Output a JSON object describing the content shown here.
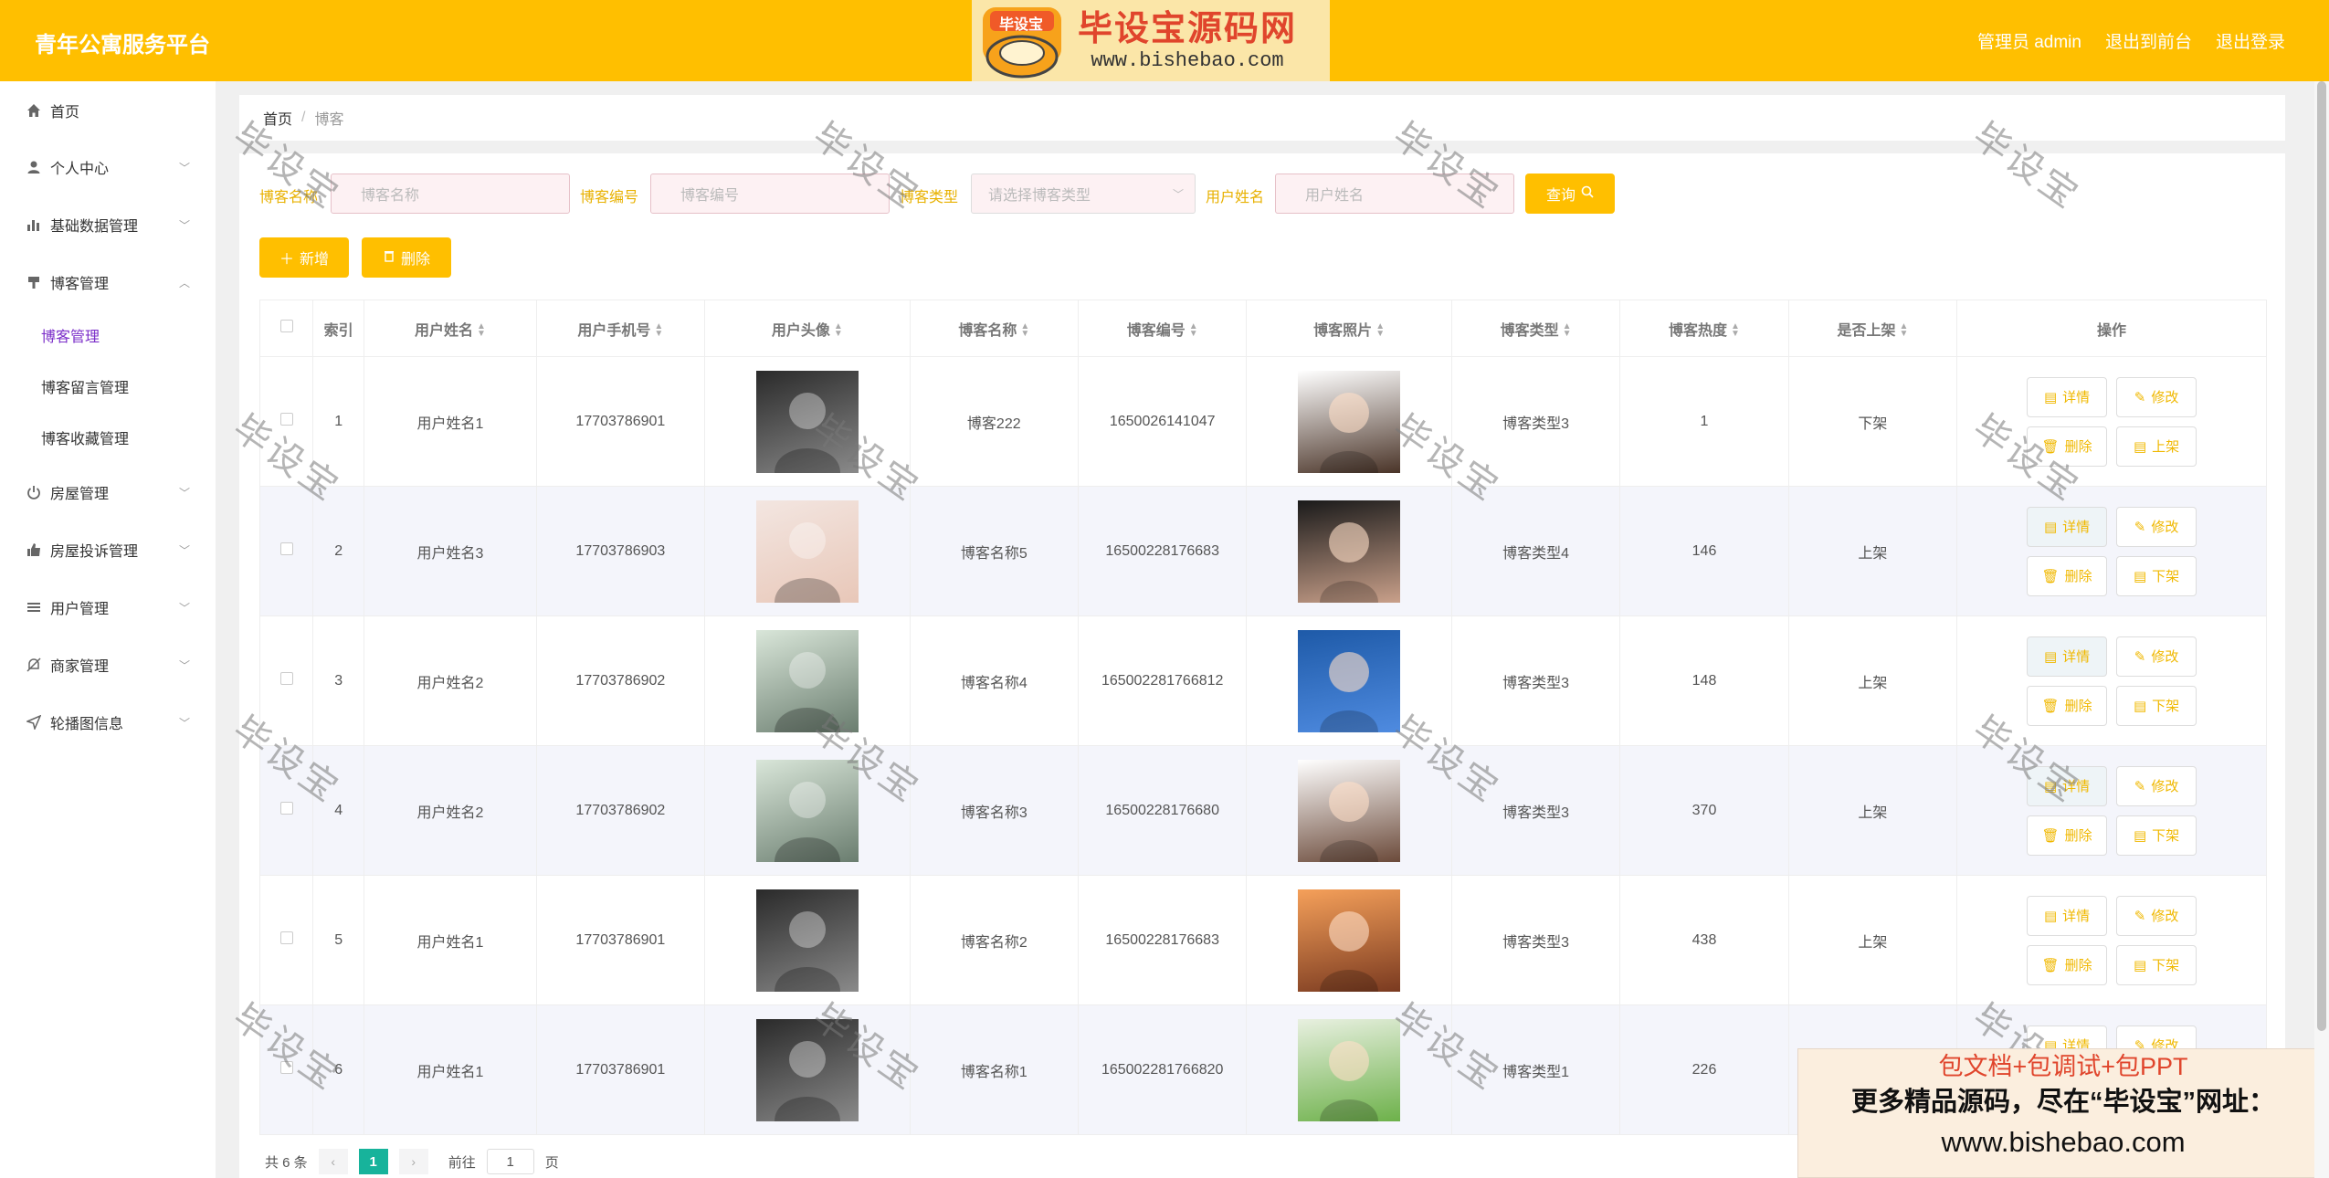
{
  "header": {
    "title": "青年公寓服务平台",
    "logo_title": "毕设宝源码网",
    "logo_url": "www.bishebao.com",
    "logo_badge": "毕设宝",
    "user_label": "管理员 admin",
    "to_front": "退出到前台",
    "logout": "退出登录",
    "bg_color": "#ffbf00"
  },
  "sidebar": {
    "items": [
      {
        "label": "首页",
        "icon": "home-icon"
      },
      {
        "label": "个人中心",
        "icon": "user-icon"
      },
      {
        "label": "基础数据管理",
        "icon": "bar-chart-icon"
      },
      {
        "label": "博客管理",
        "icon": "paint-icon"
      },
      {
        "label": "房屋管理",
        "icon": "power-icon"
      },
      {
        "label": "房屋投诉管理",
        "icon": "thumb-icon"
      },
      {
        "label": "用户管理",
        "icon": "list-icon"
      },
      {
        "label": "商家管理",
        "icon": "bell-off-icon"
      },
      {
        "label": "轮播图信息",
        "icon": "send-icon"
      }
    ],
    "sub_items": [
      {
        "label": "博客管理"
      },
      {
        "label": "博客留言管理"
      },
      {
        "label": "博客收藏管理"
      }
    ],
    "active_color": "#7b2ec9"
  },
  "breadcrumb": {
    "home": "首页",
    "sep": "/",
    "current": "博客"
  },
  "filters": {
    "name_label": "博客名称",
    "name_placeholder": "博客名称",
    "code_label": "博客编号",
    "code_placeholder": "博客编号",
    "type_label": "博客类型",
    "type_placeholder": "请选择博客类型",
    "user_label": "用户姓名",
    "user_placeholder": "用户姓名",
    "search_btn": "查询"
  },
  "actions": {
    "add": "新增",
    "delete": "删除"
  },
  "table": {
    "headers": [
      "索引",
      "用户姓名",
      "用户手机号",
      "用户头像",
      "博客名称",
      "博客编号",
      "博客照片",
      "博客类型",
      "博客热度",
      "是否上架",
      "操作"
    ],
    "rows": [
      {
        "idx": "1",
        "user": "用户姓名1",
        "phone": "17703786901",
        "name": "博客222",
        "code": "1650026141047",
        "type": "博客类型3",
        "heat": "1",
        "status": "下架",
        "toggle": "上架"
      },
      {
        "idx": "2",
        "user": "用户姓名3",
        "phone": "17703786903",
        "name": "博客名称5",
        "code": "16500228176683",
        "type": "博客类型4",
        "heat": "146",
        "status": "上架",
        "toggle": "下架"
      },
      {
        "idx": "3",
        "user": "用户姓名2",
        "phone": "17703786902",
        "name": "博客名称4",
        "code": "165002281766812",
        "type": "博客类型3",
        "heat": "148",
        "status": "上架",
        "toggle": "下架"
      },
      {
        "idx": "4",
        "user": "用户姓名2",
        "phone": "17703786902",
        "name": "博客名称3",
        "code": "16500228176680",
        "type": "博客类型3",
        "heat": "370",
        "status": "上架",
        "toggle": "下架"
      },
      {
        "idx": "5",
        "user": "用户姓名1",
        "phone": "17703786901",
        "name": "博客名称2",
        "code": "16500228176683",
        "type": "博客类型3",
        "heat": "438",
        "status": "上架",
        "toggle": "下架"
      },
      {
        "idx": "6",
        "user": "用户姓名1",
        "phone": "17703786901",
        "name": "博客名称1",
        "code": "165002281766820",
        "type": "博客类型1",
        "heat": "226",
        "status": "",
        "toggle": ""
      }
    ],
    "op_detail": "详情",
    "op_edit": "修改",
    "op_delete": "删除"
  },
  "pager": {
    "total": "共 6 条",
    "page": "1",
    "goto": "前往",
    "goto_value": "1",
    "unit": "页"
  },
  "watermark": "毕设宝",
  "ad": {
    "line1": "包文档+包调试+包PPT",
    "line2": "更多精品源码，尽在“毕设宝”网址：",
    "line3": "www.bishebao.com"
  }
}
